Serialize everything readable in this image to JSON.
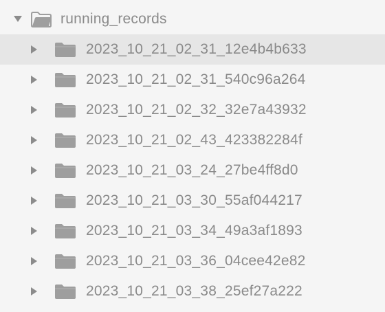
{
  "tree": {
    "root": {
      "label": "running_records",
      "expanded": true,
      "icon": "folder-open-icon"
    },
    "children": [
      {
        "label": "2023_10_21_02_31_12e4b4b633",
        "selected": true
      },
      {
        "label": "2023_10_21_02_31_540c96a264"
      },
      {
        "label": "2023_10_21_02_32_32e7a43932"
      },
      {
        "label": "2023_10_21_02_43_423382284f"
      },
      {
        "label": "2023_10_21_03_24_27be4ff8d0"
      },
      {
        "label": "2023_10_21_03_30_55af044217"
      },
      {
        "label": "2023_10_21_03_34_49a3af1893"
      },
      {
        "label": "2023_10_21_03_36_04cee42e82"
      },
      {
        "label": "2023_10_21_03_38_25ef27a222"
      }
    ],
    "colors": {
      "background": "#f5f5f5",
      "selected_row": "#e6e6e6",
      "folder": "#9e9e9e",
      "text": "#8a8a8a",
      "chevron": "#8c8c8c"
    }
  }
}
